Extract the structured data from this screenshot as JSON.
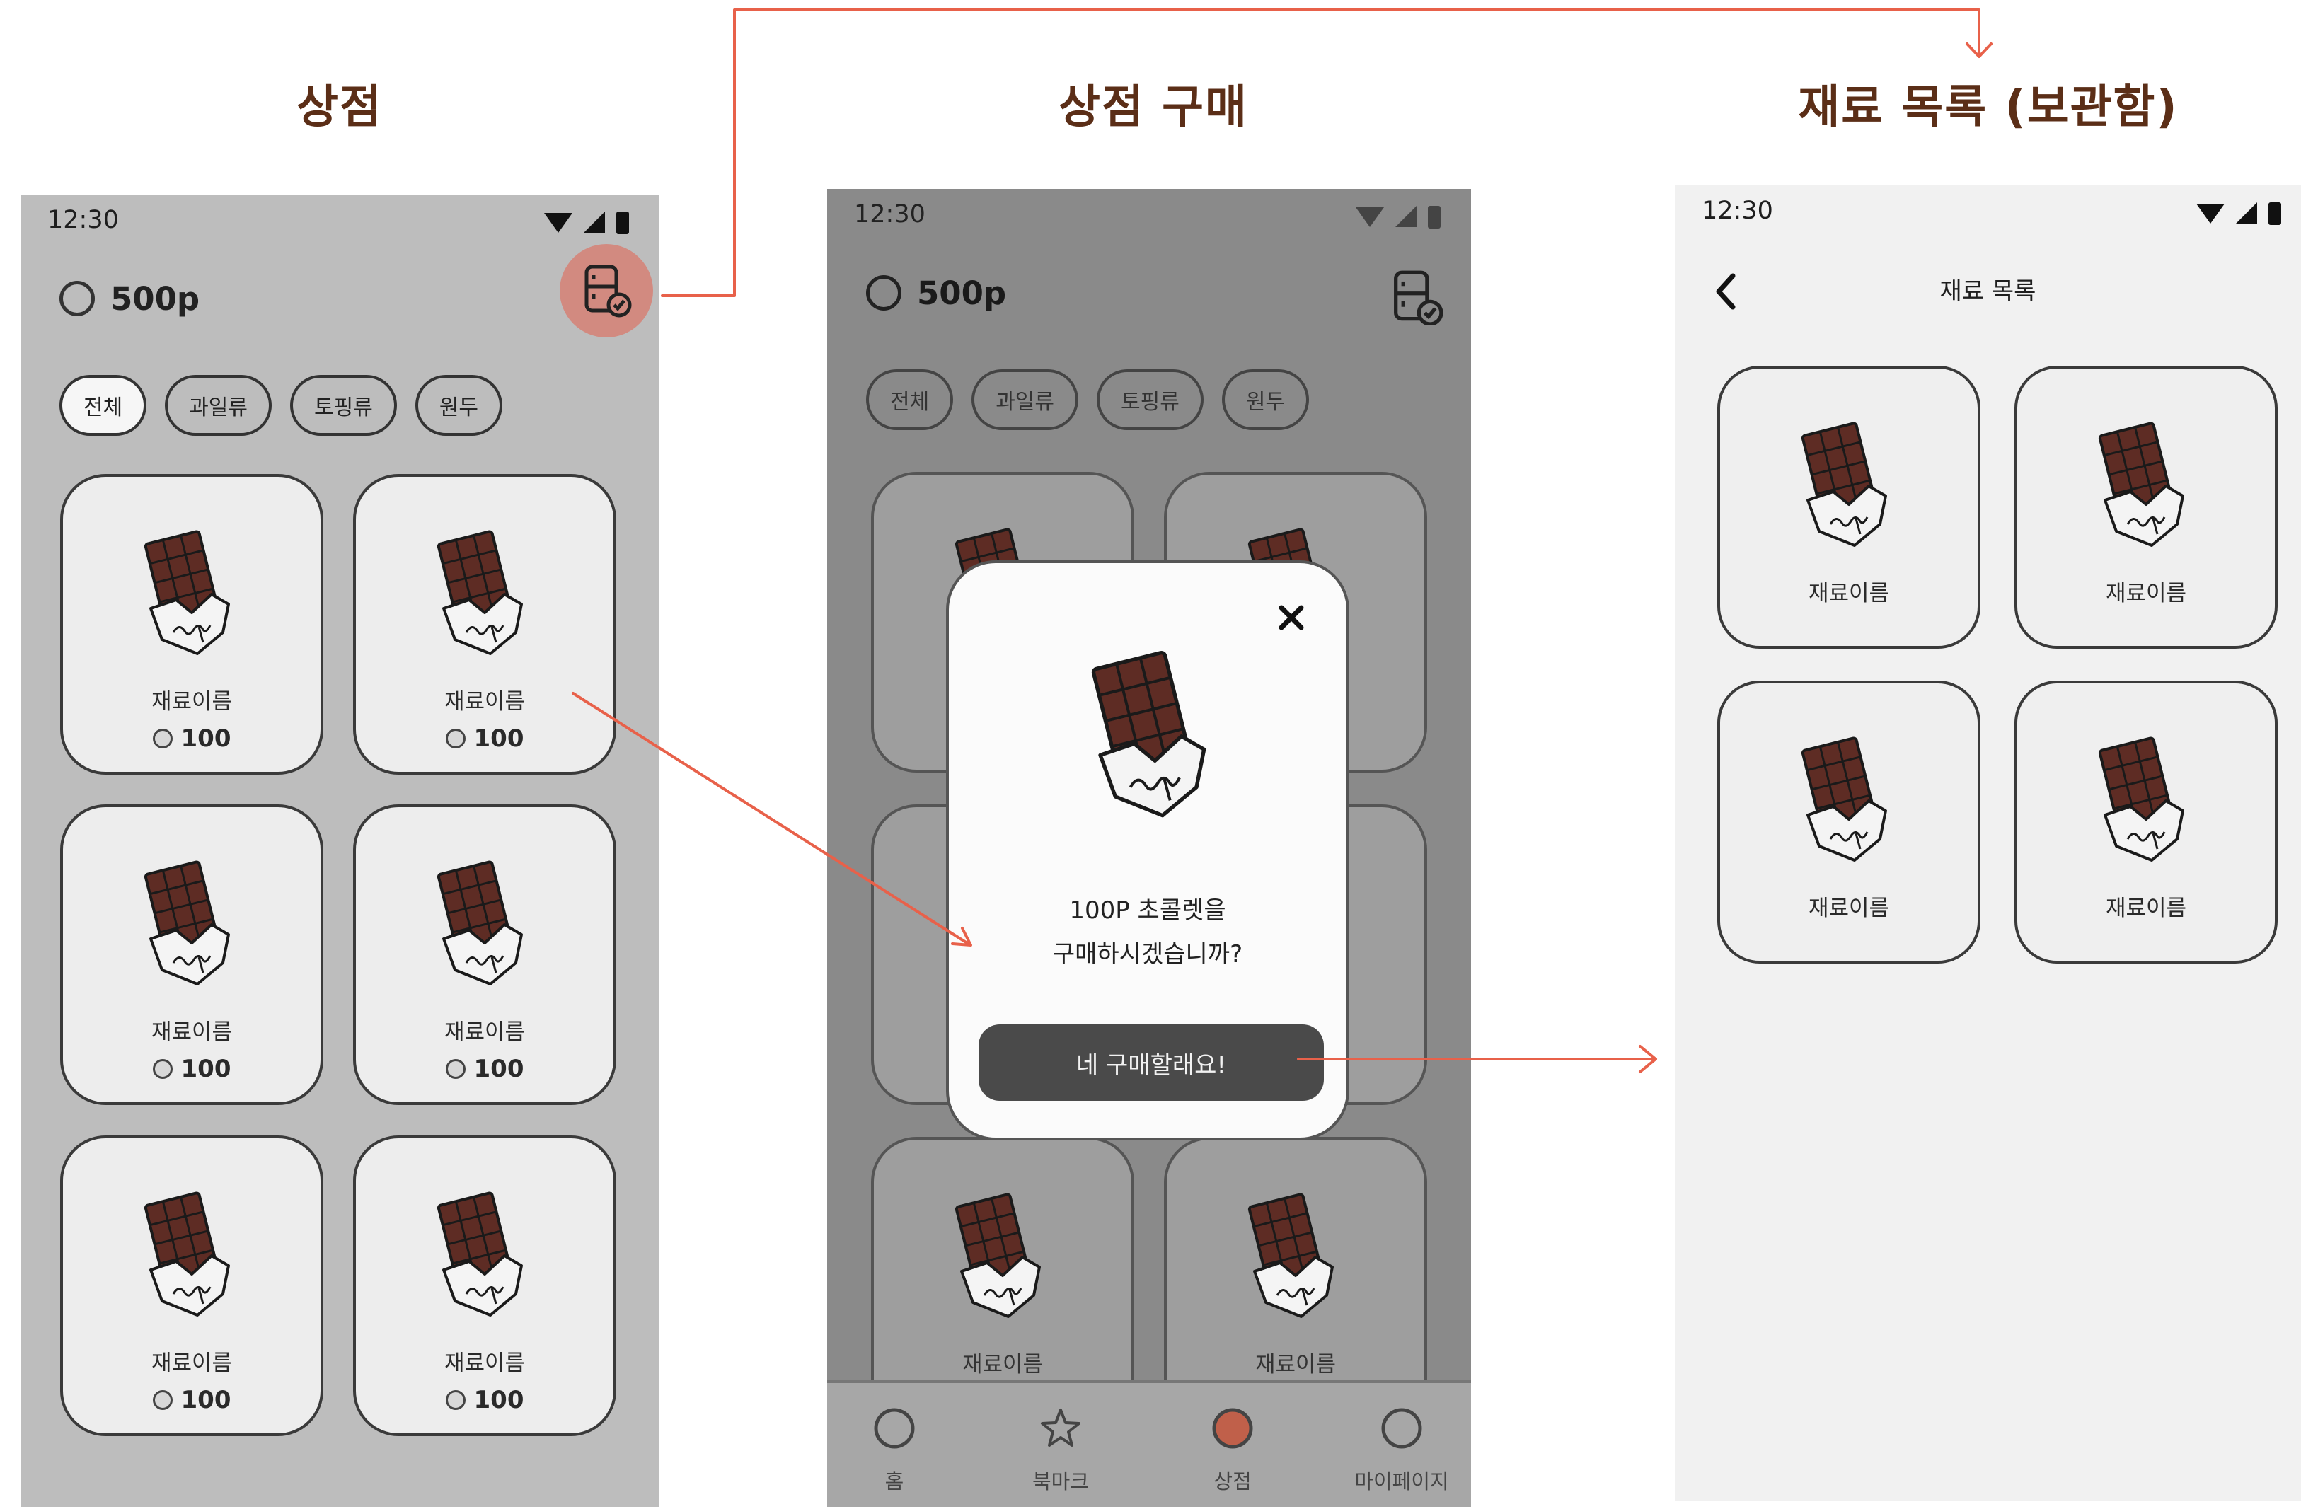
{
  "sections": {
    "shop": "상점",
    "shop_purchase": "상점 구매",
    "material_list": "재료 목록 (보관함)"
  },
  "status": {
    "time": "12:30"
  },
  "shop": {
    "points": "500p",
    "filters": [
      "전체",
      "과일류",
      "토핑류",
      "원두"
    ],
    "items": [
      {
        "name": "재료이름",
        "price": "100"
      },
      {
        "name": "재료이름",
        "price": "100"
      },
      {
        "name": "재료이름",
        "price": "100"
      },
      {
        "name": "재료이름",
        "price": "100"
      },
      {
        "name": "재료이름",
        "price": "100"
      },
      {
        "name": "재료이름",
        "price": "100"
      }
    ],
    "storage_icon": "fridge-check-icon"
  },
  "purchase": {
    "points": "500p",
    "filters": [
      "전체",
      "과일류",
      "토핑류",
      "원두"
    ],
    "bottom_items": [
      {
        "name": "재료이름"
      },
      {
        "name": "재료이름"
      }
    ],
    "modal": {
      "line1": "100P 초콜렛을",
      "line2": "구매하시겠습니까?",
      "confirm_label": "네 구매할래요!"
    },
    "nav": [
      "홈",
      "북마크",
      "상점",
      "마이페이지"
    ]
  },
  "materials": {
    "title": "재료 목록",
    "items": [
      {
        "name": "재료이름"
      },
      {
        "name": "재료이름"
      },
      {
        "name": "재료이름"
      },
      {
        "name": "재료이름"
      }
    ]
  },
  "colors": {
    "accent_flow": "#e8614a",
    "title_brown": "#5b2e17",
    "selected_nav": "#c0604a",
    "storage_highlight": "#d28a80",
    "chocolate": "#5e2c24"
  }
}
